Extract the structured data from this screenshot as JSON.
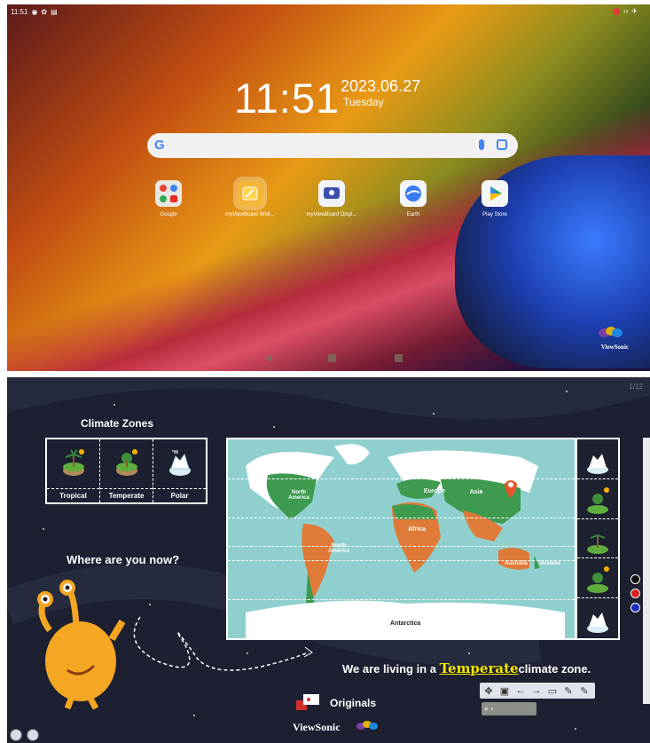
{
  "home": {
    "status_time": "11:51",
    "clock_time": "11:51",
    "date": "2023.06.27",
    "weekday": "Tuesday",
    "search_logo": "G",
    "apps": [
      {
        "label": "Google",
        "icon": "google-folder-icon"
      },
      {
        "label": "myViewBoard Whit...",
        "icon": "whiteboard-icon"
      },
      {
        "label": "myViewBoard Displ...",
        "icon": "display-icon"
      },
      {
        "label": "Earth",
        "icon": "earth-icon"
      },
      {
        "label": "Play Store",
        "icon": "play-store-icon"
      }
    ],
    "brand": "ViewSonic"
  },
  "lesson": {
    "page_indicator": "1/12",
    "climate_title": "Climate Zones",
    "zones": [
      "Tropical",
      "Temperate",
      "Polar"
    ],
    "question": "Where are you now?",
    "map_labels": {
      "north_america": "North America",
      "south_america": "South America",
      "europe": "Europe",
      "asia": "Asia",
      "africa": "Africa",
      "australia": "Australia",
      "oceania": "Oceania",
      "antarctica": "Antarctica"
    },
    "living_pre": "We are living in a ",
    "living_highlight": "Temperate",
    "living_post": "climate zone.",
    "originals": "Originals",
    "brand": "ViewSonic",
    "pen_colors": [
      "#111111",
      "#d81e1e",
      "#1a2fc0"
    ]
  }
}
